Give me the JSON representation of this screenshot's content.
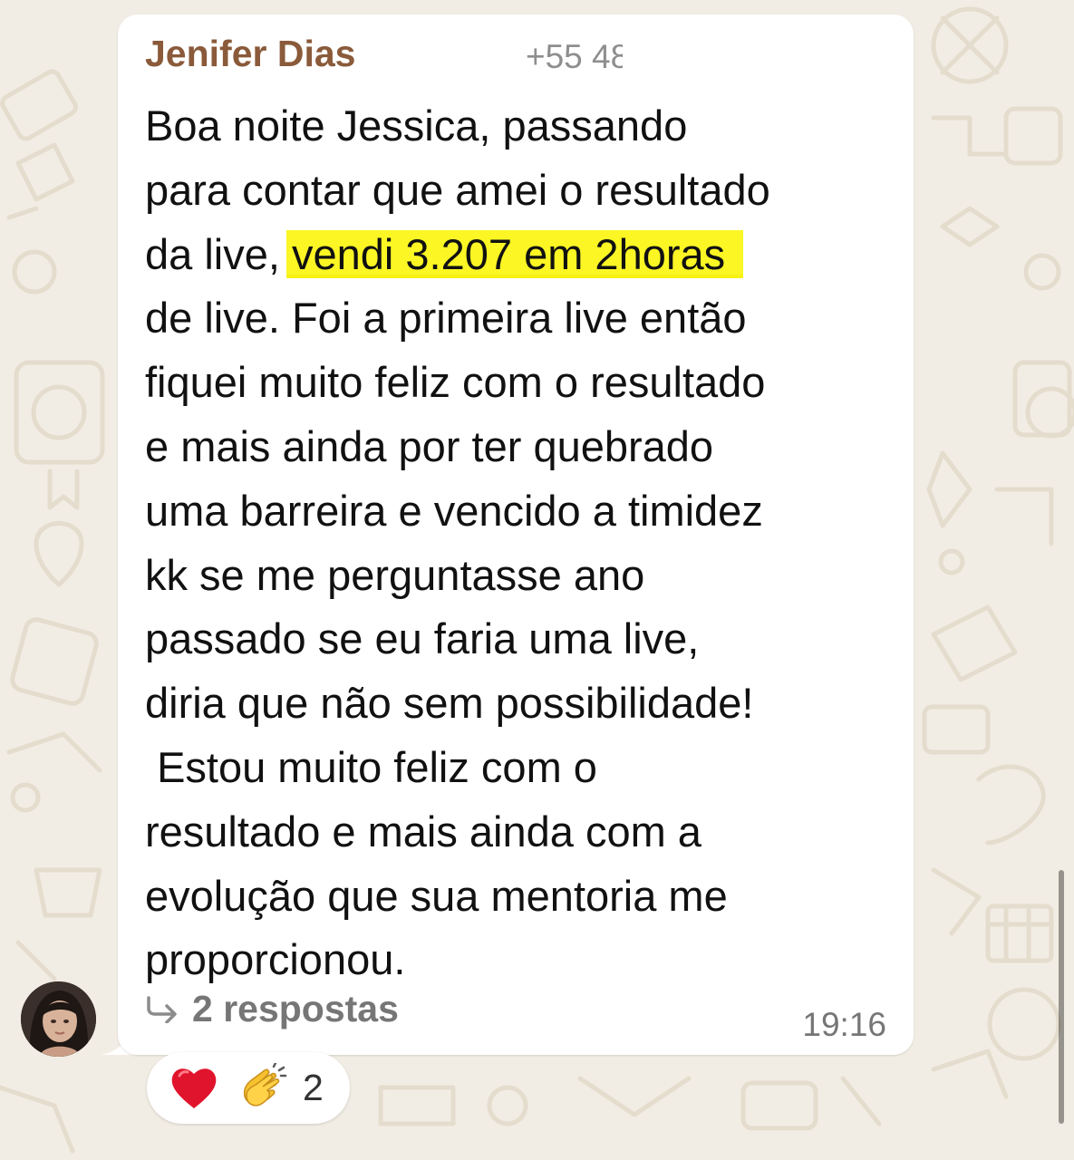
{
  "message": {
    "sender_name": "Jenifer Dias",
    "sender_phone_visible": "+55 48",
    "body_before_highlight": "Boa noite Jessica, passando\npara contar que amei o resultado\nda live, ",
    "highlighted_text": "vendi 3.207 em 2horas",
    "body_after_highlight": "\nde live. Foi a primeira live então\nfiquei muito feliz com o resultado\ne mais ainda por ter quebrado\numa barreira e vencido a timidez\nkk se me perguntasse ano\npassado se eu faria uma live,\ndiria que não sem possibilidade!\n Estou muito feliz com o\nresultado e mais ainda com a\nevolução que sua mentoria me\nproporcionou.",
    "replies_label": "2 respostas",
    "time": "19:16"
  },
  "reactions": {
    "emojis": [
      "red-heart",
      "clapping-hands"
    ],
    "count": "2"
  },
  "colors": {
    "sender_name": "#8a5a3a",
    "highlight": "#fbf624",
    "wallpaper": "#f2ede4",
    "meta_text": "#767676"
  }
}
